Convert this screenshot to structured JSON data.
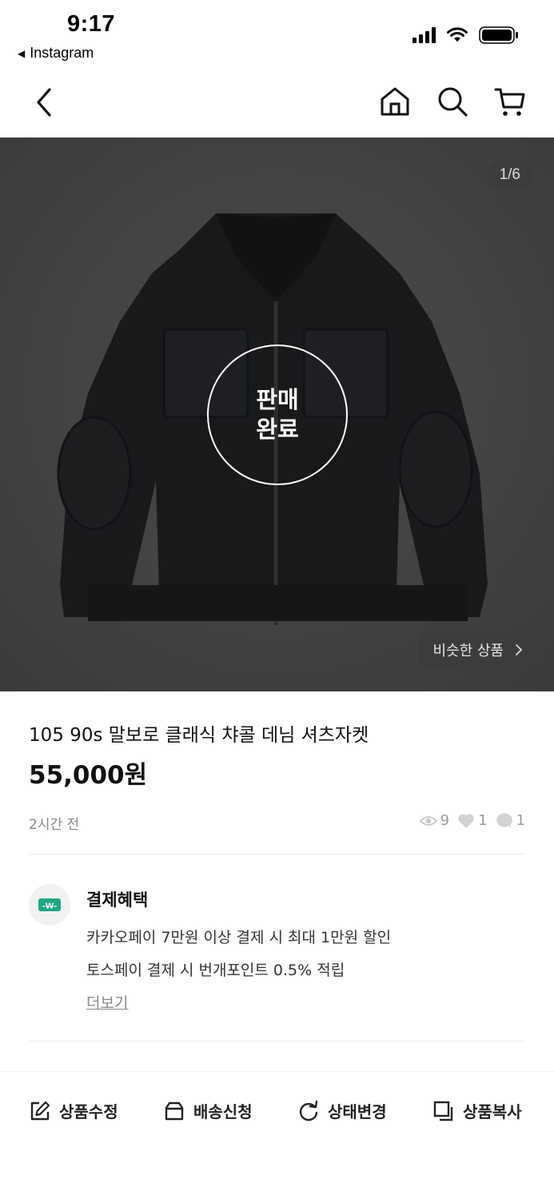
{
  "status": {
    "time": "9:17",
    "back_app": "Instagram"
  },
  "nav": {
    "back_icon": "back-chevron-icon",
    "home_icon": "home-icon",
    "search_icon": "search-icon",
    "cart_icon": "cart-icon"
  },
  "image": {
    "counter": "1/6",
    "sold_line1": "판매",
    "sold_line2": "완료",
    "similar_label": "비슷한 상품"
  },
  "product": {
    "title": "105 90s 말보로 클래식 챠콜 데님 셔츠자켓",
    "price": "55,000원",
    "time_ago": "2시간 전",
    "views": "9",
    "likes": "1",
    "chats": "1"
  },
  "payment": {
    "title": "결제혜택",
    "lines": [
      "카카오페이 7만원 이상 결제 시 최대 1만원 할인",
      "토스페이 결제 시 번개포인트 0.5% 적립"
    ],
    "more": "더보기"
  },
  "actions": [
    {
      "label": "상품수정",
      "icon": "edit-icon"
    },
    {
      "label": "배송신청",
      "icon": "box-icon"
    },
    {
      "label": "상태변경",
      "icon": "refresh-icon"
    },
    {
      "label": "상품복사",
      "icon": "copy-icon"
    }
  ]
}
